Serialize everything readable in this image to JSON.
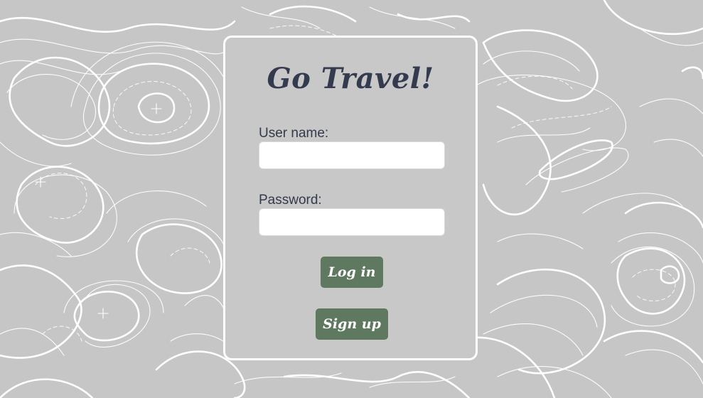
{
  "login": {
    "title": "Go Travel!",
    "username_label": "User name:",
    "username_value": "",
    "password_label": "Password:",
    "password_value": "",
    "login_button": "Log in",
    "signup_button": "Sign up"
  },
  "colors": {
    "background": "#c6c6c6",
    "card_border": "#ffffff",
    "title": "#343b4f",
    "button": "#5f7960",
    "button_text": "#ffffff"
  }
}
